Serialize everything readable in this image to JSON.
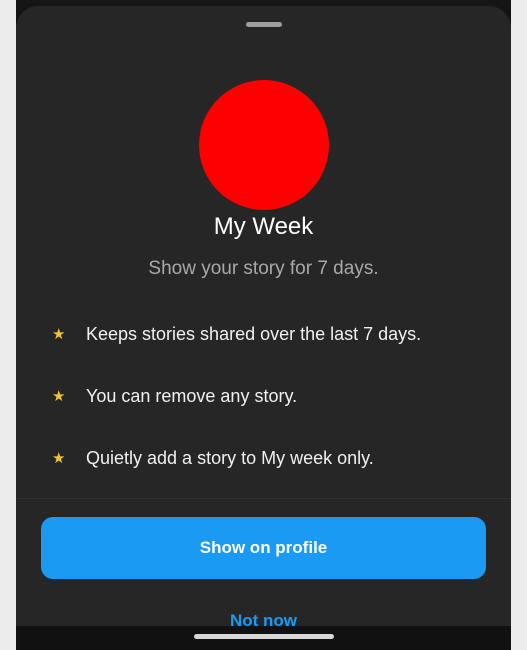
{
  "sheet": {
    "title": "My Week",
    "subtitle": "Show your story for 7 days.",
    "avatar_color": "#ff0000",
    "features": [
      {
        "icon": "star-icon",
        "text": "Keeps stories shared over the last 7 days."
      },
      {
        "icon": "star-icon",
        "text": "You can remove any story."
      },
      {
        "icon": "star-icon",
        "text": "Quietly add a story to My week only."
      }
    ],
    "primary_button_label": "Show on profile",
    "secondary_button_label": "Not now"
  },
  "colors": {
    "sheet_background": "#262626",
    "accent": "#1b9af3",
    "star": "#f2c230"
  },
  "glyphs": {
    "star": "★"
  }
}
